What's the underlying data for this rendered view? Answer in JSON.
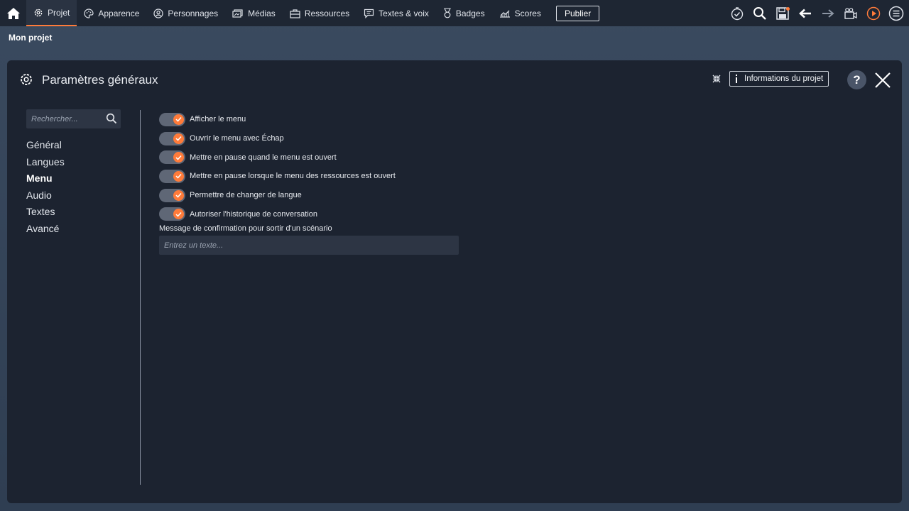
{
  "topbar": {
    "nav": [
      {
        "label": "Projet",
        "icon": "gear-icon"
      },
      {
        "label": "Apparence",
        "icon": "palette-icon"
      },
      {
        "label": "Personnages",
        "icon": "character-icon"
      },
      {
        "label": "Médias",
        "icon": "media-icon"
      },
      {
        "label": "Ressources",
        "icon": "briefcase-icon"
      },
      {
        "label": "Textes & voix",
        "icon": "speech-icon"
      },
      {
        "label": "Badges",
        "icon": "medal-icon"
      },
      {
        "label": "Scores",
        "icon": "chart-icon"
      }
    ],
    "active_index": 0,
    "publish_label": "Publier",
    "tools": [
      "check-clock-icon",
      "search-icon",
      "save-icon",
      "undo-icon",
      "redo-icon",
      "video-icon",
      "play-icon",
      "menu-icon"
    ],
    "accent": "#ff7b3a"
  },
  "breadcrumb": "Mon projet",
  "panel": {
    "title": "Paramètres généraux",
    "info_button": "Informations du projet",
    "help_label": "?"
  },
  "sidebar": {
    "search_placeholder": "Rechercher...",
    "items": [
      "Général",
      "Langues",
      "Menu",
      "Audio",
      "Textes",
      "Avancé"
    ],
    "active_index": 2
  },
  "options": [
    {
      "label": "Afficher le menu",
      "checked": true
    },
    {
      "label": "Ouvrir le menu avec Échap",
      "checked": true
    },
    {
      "label": "Mettre en pause quand le menu est ouvert",
      "checked": true
    },
    {
      "label": "Mettre en pause lorsque le menu des ressources est ouvert",
      "checked": true
    },
    {
      "label": "Permettre de changer de langue",
      "checked": true
    },
    {
      "label": "Autoriser l'historique de conversation",
      "checked": true
    }
  ],
  "confirm_field": {
    "label": "Message de confirmation pour sortir d'un scénario",
    "placeholder": "Entrez un texte...",
    "value": ""
  }
}
